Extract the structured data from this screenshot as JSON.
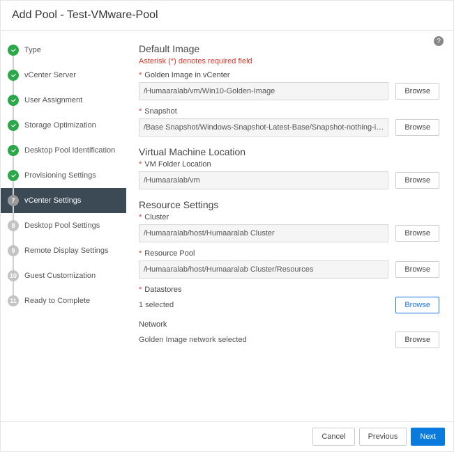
{
  "header": {
    "title": "Add Pool - Test-VMware-Pool"
  },
  "steps": [
    {
      "num": "1",
      "label": "Type",
      "state": "done"
    },
    {
      "num": "2",
      "label": "vCenter Server",
      "state": "done"
    },
    {
      "num": "3",
      "label": "User Assignment",
      "state": "done"
    },
    {
      "num": "4",
      "label": "Storage Optimization",
      "state": "done"
    },
    {
      "num": "5",
      "label": "Desktop Pool Identification",
      "state": "done"
    },
    {
      "num": "6",
      "label": "Provisioning Settings",
      "state": "done"
    },
    {
      "num": "7",
      "label": "vCenter Settings",
      "state": "current"
    },
    {
      "num": "8",
      "label": "Desktop Pool Settings",
      "state": "future"
    },
    {
      "num": "9",
      "label": "Remote Display Settings",
      "state": "future"
    },
    {
      "num": "10",
      "label": "Guest Customization",
      "state": "future"
    },
    {
      "num": "11",
      "label": "Ready to Complete",
      "state": "future"
    }
  ],
  "sections": {
    "defaultImage": {
      "title": "Default Image",
      "requiredNote": "Asterisk (*) denotes required field",
      "goldenImage": {
        "label": "Golden Image in vCenter",
        "value": "/Humaaralab/vm/Win10-Golden-Image",
        "browse": "Browse"
      },
      "snapshot": {
        "label": "Snapshot",
        "value": "/Base Snapshot/Windows-Snapshot-Latest-Base/Snapshot-nothing-installed-all-",
        "browse": "Browse"
      }
    },
    "vmLocation": {
      "title": "Virtual Machine Location",
      "vmFolder": {
        "label": "VM Folder Location",
        "value": "/Humaaralab/vm",
        "browse": "Browse"
      }
    },
    "resource": {
      "title": "Resource Settings",
      "cluster": {
        "label": "Cluster",
        "value": "/Humaaralab/host/Humaaralab Cluster",
        "browse": "Browse"
      },
      "resourcePool": {
        "label": "Resource Pool",
        "value": "/Humaaralab/host/Humaaralab Cluster/Resources",
        "browse": "Browse"
      },
      "datastores": {
        "label": "Datastores",
        "value": "1 selected",
        "browse": "Browse"
      },
      "network": {
        "label": "Network",
        "value": "Golden Image network selected",
        "browse": "Browse"
      }
    }
  },
  "footer": {
    "cancel": "Cancel",
    "previous": "Previous",
    "next": "Next"
  },
  "help": "?"
}
